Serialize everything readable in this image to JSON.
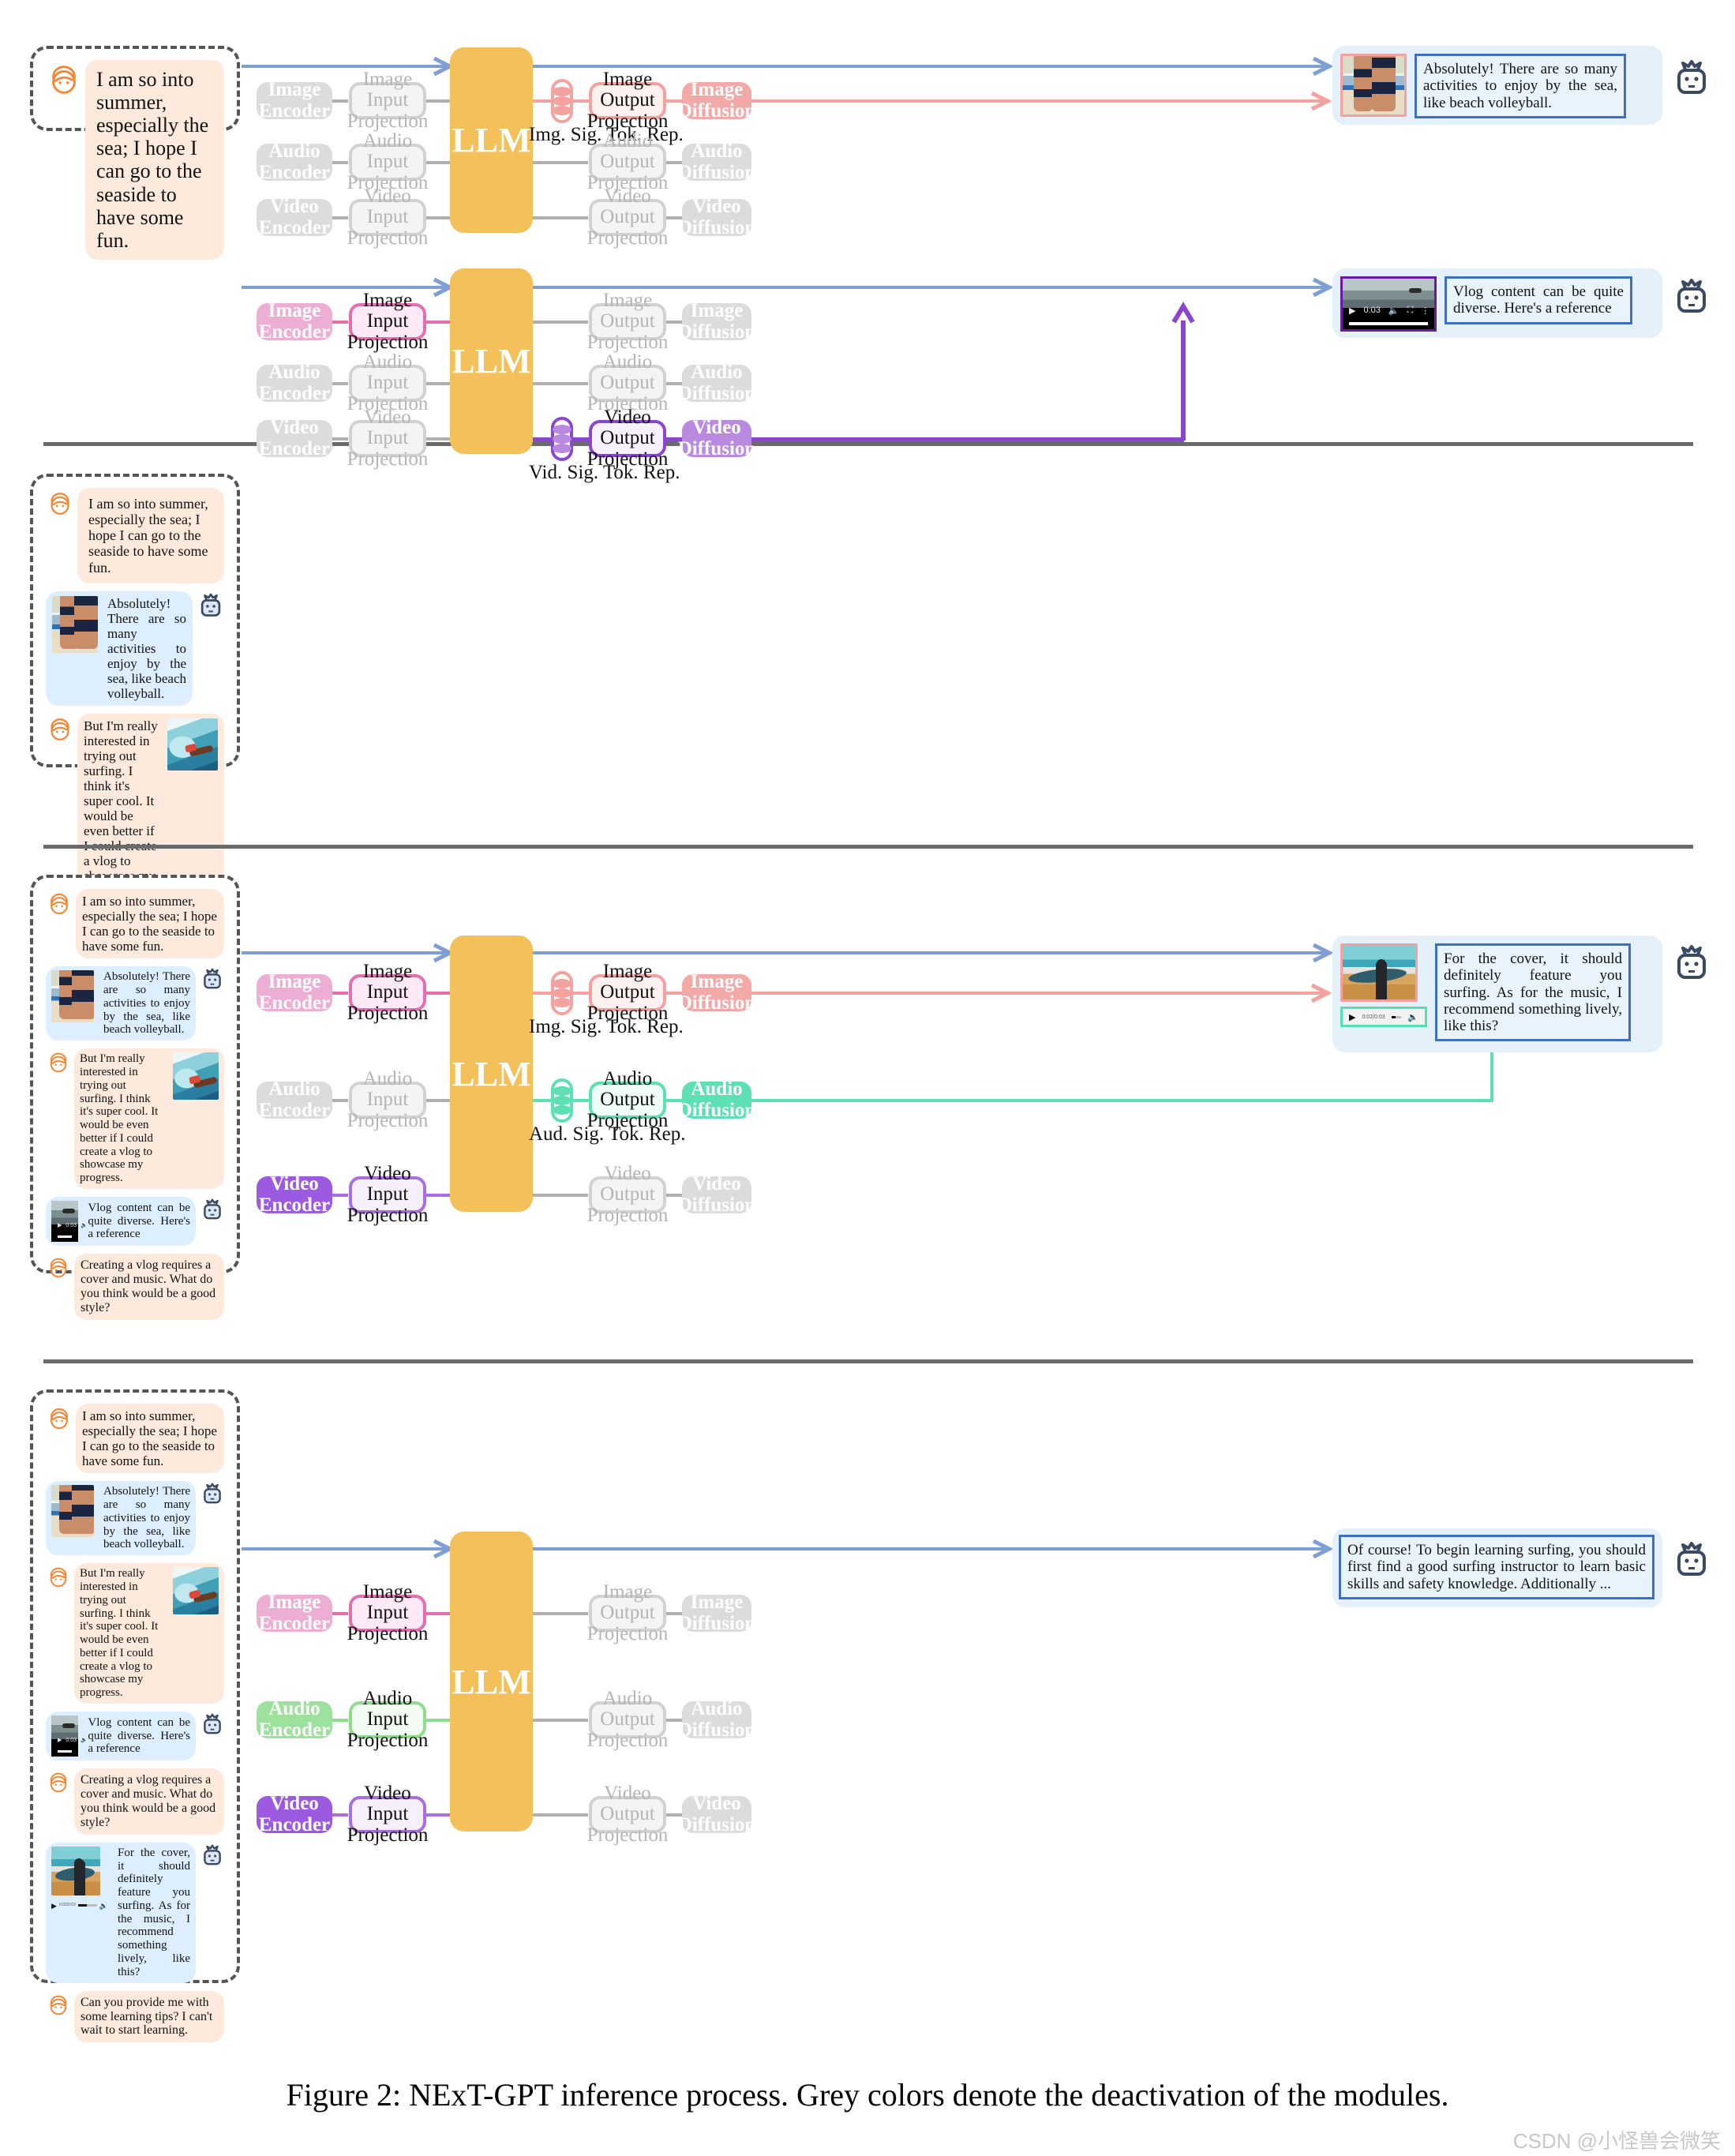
{
  "figure": {
    "caption": "Figure 2: NExT-GPT inference process. Grey colors denote the deactivation of the modules.",
    "watermark": "CSDN @小怪兽会微笑"
  },
  "labels": {
    "llm": "LLM",
    "image_encoder": "Image Encoder",
    "audio_encoder": "Audio Encoder",
    "video_encoder": "Video Encoder",
    "image_input_projection": "Image Input Projection",
    "audio_input_projection": "Audio Input Projection",
    "video_input_projection": "Video Input Projection",
    "image_output_projection": "Image Output Projection",
    "audio_output_projection": "Audio Output Projection",
    "video_output_projection": "Video Output Projection",
    "image_diffusion": "Image Diffusion",
    "audio_diffusion": "Audio Diffusion",
    "video_diffusion": "Video Diffusion",
    "img_sig_tok_rep": "Img. Sig. Tok. Rep.",
    "vid_sig_tok_rep": "Vid. Sig. Tok. Rep.",
    "aud_sig_tok_rep": "Aud. Sig. Tok. Rep."
  },
  "messages": {
    "user1": "I am so into summer, especially the sea; I hope I can go to the seaside to have some fun.",
    "bot1": "Absolutely! There are so many activities to enjoy by the sea, like beach volleyball.",
    "user2": " But I'm really interested in trying out surfing. I think it's super cool. It would be even better if I could create a vlog to showcase my progress.",
    "bot2": " Vlog content can be quite diverse. Here's a reference",
    "user3": "Creating a vlog requires a cover and music. What do you think would be a good style?",
    "bot3": "For the cover, it should definitely feature you surfing. As for the music, I recommend something lively, like this?",
    "user4": "Can you provide me with some learning tips? I can't wait to start learning.",
    "bot4": "Of course! To begin learning surfing, you should first find a good surfing instructor to learn basic skills and safety knowledge. Additionally ..."
  },
  "media": {
    "video_time": "0:03",
    "audio_time": "0:02/0:03"
  },
  "colors": {
    "llm": "#f3c05a",
    "image": "#e46fb0",
    "image_out": "#f4a2a0",
    "audio": "#8edc8e",
    "audio_out": "#5ce0b4",
    "video": "#a96fe0",
    "video_out": "#8b46cf",
    "inactive": "#d2d2d2",
    "text_flow": "#7f9fd4"
  }
}
